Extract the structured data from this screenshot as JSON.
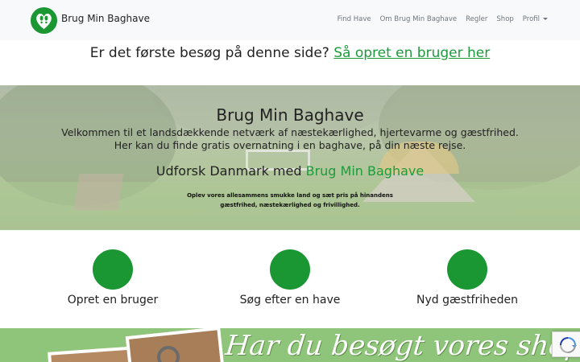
{
  "navbar": {
    "brand": "Brug Min Baghave",
    "items": [
      "Find Have",
      "Om Brug Min Baghave",
      "Regler",
      "Shop",
      "Profil"
    ]
  },
  "prompt": {
    "text": "Er det første besøg på denne side?",
    "link": "Så opret en bruger her"
  },
  "hero": {
    "title": "Brug Min Baghave",
    "subtitle_line1": "Velkommen til et landsdækkende netværk af næstekærlighed, hjertevarme og gæstfrihed.",
    "subtitle_line2": "Her kan du finde gratis overnatning i en baghave, på din næste rejse.",
    "explore_prefix": "Udforsk Danmark med",
    "explore_brand": "Brug Min Baghave",
    "small_line1": "Oplev vores allesammens smukke land og sæt pris på hinandens",
    "small_line2": "gæstfrihed, næstekærlighed og frivillighed."
  },
  "features": [
    {
      "label": "Opret en bruger"
    },
    {
      "label": "Søg efter en have"
    },
    {
      "label": "Nyd gæstfriheden"
    }
  ],
  "shop_banner": {
    "text": "Har du besøgt vores shop?"
  },
  "colors": {
    "accent": "#1e9a3c",
    "feature_circle": "#1a9633",
    "banner_bg": "#8fc57a",
    "navbar_bg": "#f8f9fa"
  },
  "icons": {
    "logo": "heart-footprints-icon",
    "recaptcha": "recaptcha-icon"
  }
}
